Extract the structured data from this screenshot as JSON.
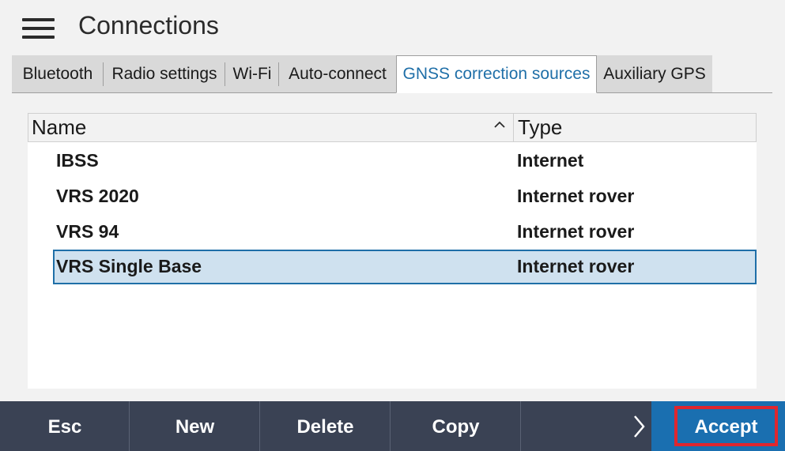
{
  "header": {
    "title": "Connections",
    "menu_icon": "hamburger-menu-icon"
  },
  "tabs": [
    {
      "label": "Bluetooth",
      "active": false
    },
    {
      "label": "Radio settings",
      "active": false
    },
    {
      "label": "Wi-Fi",
      "active": false
    },
    {
      "label": "Auto-connect",
      "active": false
    },
    {
      "label": "GNSS correction sources",
      "active": true
    },
    {
      "label": "Auxiliary GPS",
      "active": false
    }
  ],
  "table": {
    "columns": [
      {
        "label": "Name",
        "sort": "ascending",
        "sort_icon": "chevron-up-icon"
      },
      {
        "label": "Type"
      }
    ],
    "rows": [
      {
        "name": "IBSS",
        "type": "Internet",
        "selected": false
      },
      {
        "name": "VRS 2020",
        "type": "Internet rover",
        "selected": false
      },
      {
        "name": "VRS 94",
        "type": "Internet rover",
        "selected": false
      },
      {
        "name": "VRS Single Base",
        "type": "Internet rover",
        "selected": true
      }
    ]
  },
  "footer": {
    "buttons": [
      {
        "label": "Esc"
      },
      {
        "label": "New"
      },
      {
        "label": "Delete"
      },
      {
        "label": "Copy"
      },
      {
        "label": ""
      }
    ],
    "next_icon": "chevron-right-icon",
    "accept_label": "Accept"
  },
  "colors": {
    "accent": "#1f6fa8",
    "footer_bg": "#3a4254",
    "accept_bg": "#1a6fb0",
    "selection_bg": "#cfe1ef",
    "highlight_border": "#e0262e"
  }
}
